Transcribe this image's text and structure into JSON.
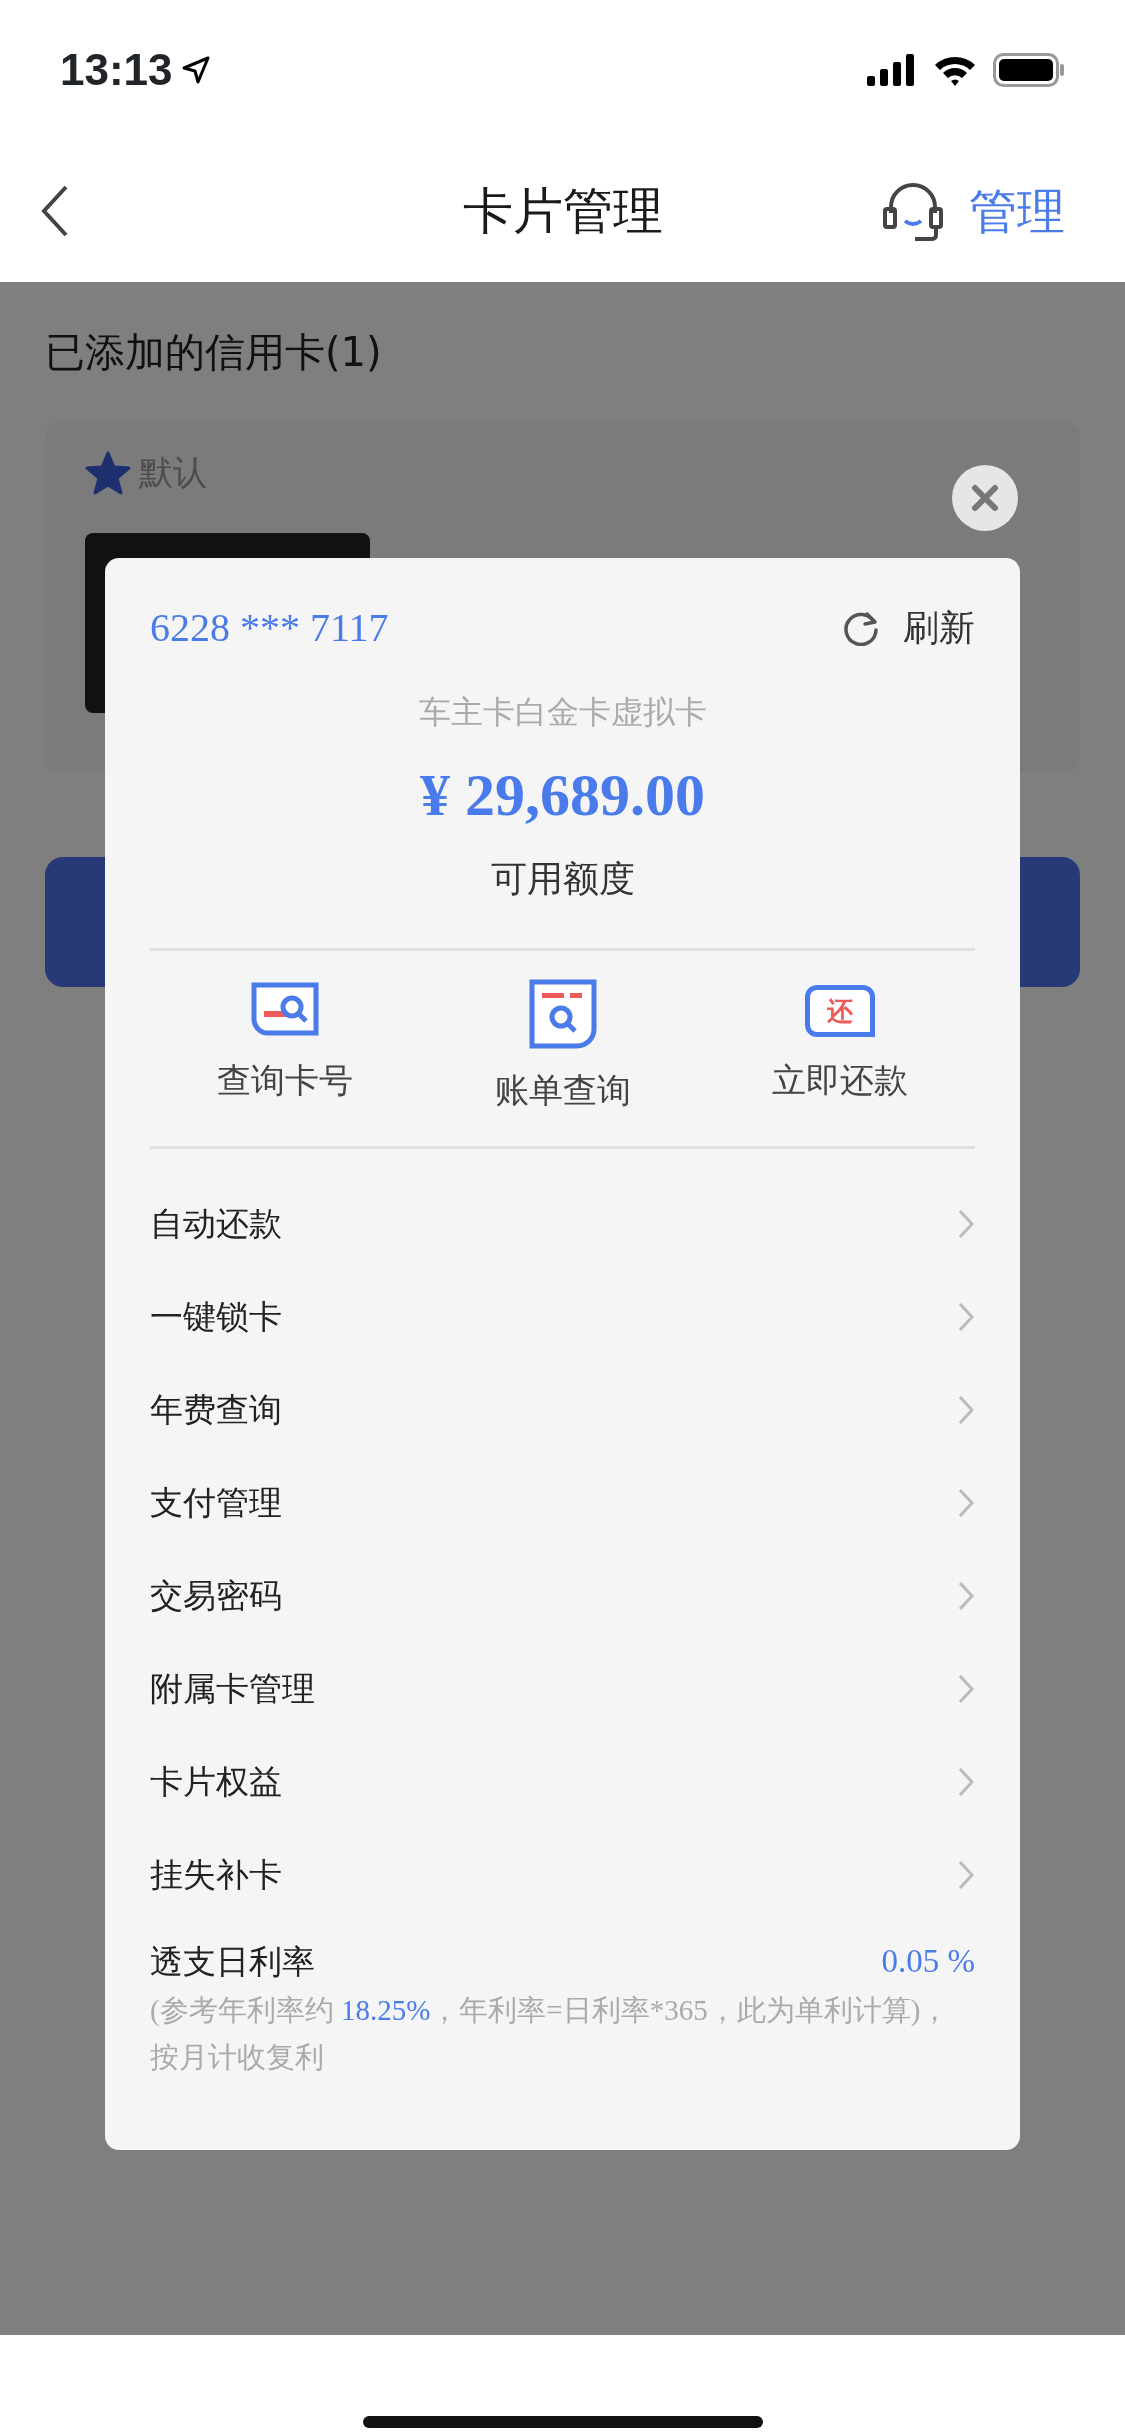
{
  "status_bar": {
    "time": "13:13"
  },
  "nav": {
    "title": "卡片管理",
    "action": "管理"
  },
  "background": {
    "section_title": "已添加的信用卡(1)",
    "default_label": "默认"
  },
  "dialog": {
    "card_number": "6228 *** 7117",
    "refresh": "刷新",
    "card_name": "车主卡白金卡虚拟卡",
    "amount": "¥ 29,689.00",
    "amount_label": "可用额度",
    "actions": [
      {
        "label": "查询卡号",
        "kind": "card-search"
      },
      {
        "label": "账单查询",
        "kind": "bill-search"
      },
      {
        "label": "立即还款",
        "kind": "repay",
        "icon_text": "还"
      }
    ],
    "menu": [
      {
        "label": "自动还款"
      },
      {
        "label": "一键锁卡"
      },
      {
        "label": "年费查询"
      },
      {
        "label": "支付管理"
      },
      {
        "label": "交易密码"
      },
      {
        "label": "附属卡管理"
      },
      {
        "label": "卡片权益"
      },
      {
        "label": "挂失补卡"
      }
    ],
    "rate": {
      "label": "透支日利率",
      "value": "0.05 %",
      "note_before": "(参考年利率约 ",
      "note_highlight": "18.25%",
      "note_after": "，年利率=日利率*365，此为单利计算)，按月计收复利"
    }
  }
}
